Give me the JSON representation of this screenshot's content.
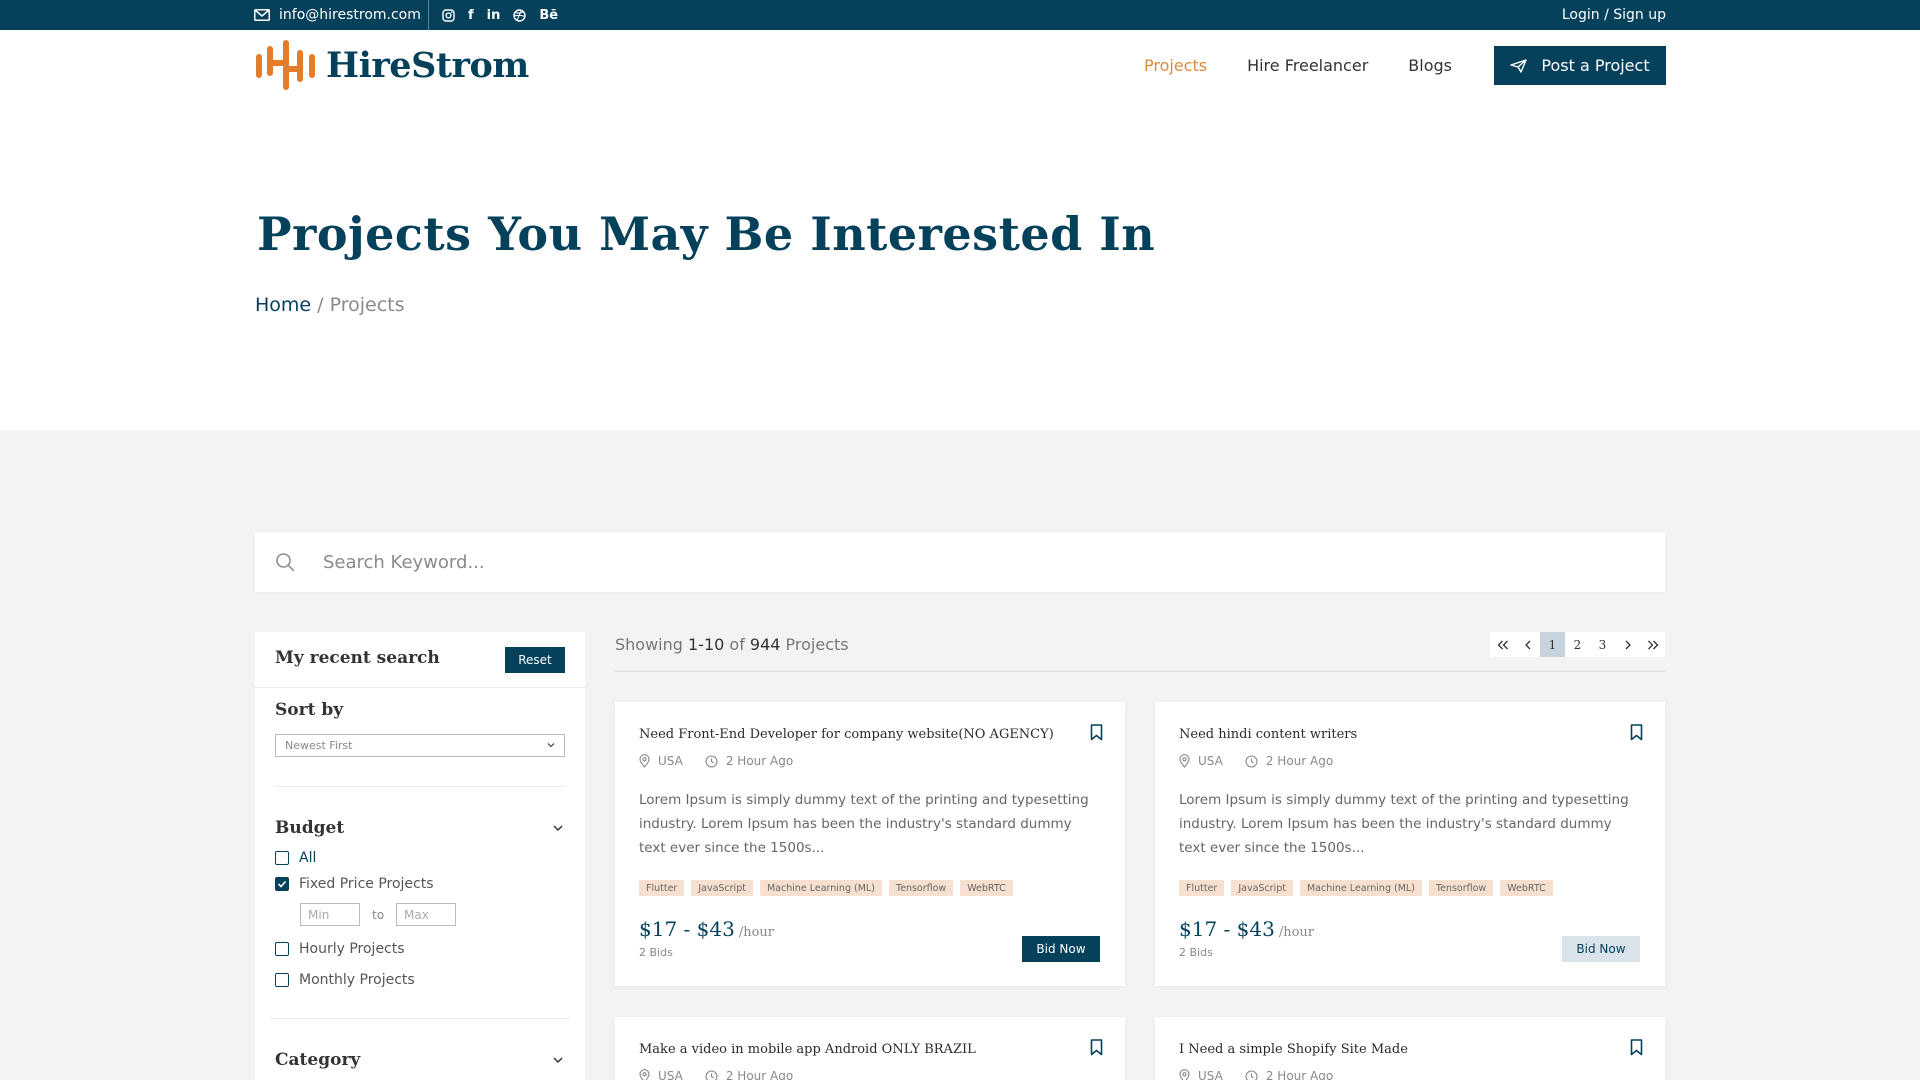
{
  "topbar": {
    "email": "info@hirestrom.com",
    "socials": [
      {
        "icon": "instagram-icon",
        "glyph": ""
      },
      {
        "icon": "facebook-icon",
        "glyph": "f"
      },
      {
        "icon": "linkedin-icon",
        "glyph": "in"
      },
      {
        "icon": "dribbble-icon",
        "glyph": ""
      },
      {
        "icon": "behance-icon",
        "glyph": "Bē"
      }
    ],
    "login": "Login / Sign up"
  },
  "header": {
    "brand": "HireStrom",
    "nav": [
      {
        "label": "Projects",
        "active": true
      },
      {
        "label": "Hire Freelancer",
        "active": false
      },
      {
        "label": "Blogs",
        "active": false
      }
    ],
    "post_button": "Post a Project"
  },
  "hero": {
    "title": "Projects You May Be Interested In",
    "breadcrumb_home": "Home",
    "breadcrumb_sep": " / ",
    "breadcrumb_current": "Projects"
  },
  "search": {
    "placeholder": "Search Keyword..."
  },
  "sidebar": {
    "recent_title": "My recent search",
    "reset_label": "Reset",
    "sort_label": "Sort by",
    "sort_value": "Newest First",
    "budget_label": "Budget",
    "budget_options": [
      {
        "label": "All",
        "checked": false
      },
      {
        "label": "Fixed Price Projects",
        "checked": true
      },
      {
        "label": "Hourly Projects",
        "checked": false
      },
      {
        "label": "Monthly Projects",
        "checked": false
      }
    ],
    "min_placeholder": "Min",
    "range_to": "to",
    "max_placeholder": "Max",
    "category_label": "Category"
  },
  "results": {
    "showing_prefix": "Showing ",
    "range": "1-10",
    "of": " of ",
    "total": "944",
    "suffix": " Projects",
    "pages": [
      "1",
      "2",
      "3"
    ],
    "active_page": "1"
  },
  "projects": [
    {
      "title": "Need Front-End Developer for company website(NO AGENCY)",
      "location": "USA",
      "time": "2 Hour Ago",
      "description": "Lorem Ipsum is simply dummy text of the printing and typesetting industry. Lorem Ipsum has been the industry's standard dummy text ever since the 1500s...",
      "tags": [
        "Flutter",
        "JavaScript",
        "Machine Learning (ML)",
        "Tensorflow",
        "WebRTC"
      ],
      "price": "$17 - $43",
      "unit": "/hour",
      "bids": "2 Bids",
      "bid_label": "Bid Now"
    },
    {
      "title": "Need hindi content writers",
      "location": "USA",
      "time": "2 Hour Ago",
      "description": "Lorem Ipsum is simply dummy text of the printing and typesetting industry. Lorem Ipsum has been the industry's standard dummy text ever since the 1500s...",
      "tags": [
        "Flutter",
        "JavaScript",
        "Machine Learning (ML)",
        "Tensorflow",
        "WebRTC"
      ],
      "price": "$17 - $43",
      "unit": "/hour",
      "bids": "2 Bids",
      "bid_label": "Bid Now"
    },
    {
      "title": "Make a video in mobile app Android ONLY BRAZIL",
      "location": "USA",
      "time": "2 Hour Ago"
    },
    {
      "title": "I Need a simple Shopify Site Made",
      "location": "USA",
      "time": "2 Hour Ago"
    }
  ],
  "colors": {
    "primary": "#06415c",
    "accent": "#e08a3c",
    "tag_bg": "#f7e0cf"
  }
}
